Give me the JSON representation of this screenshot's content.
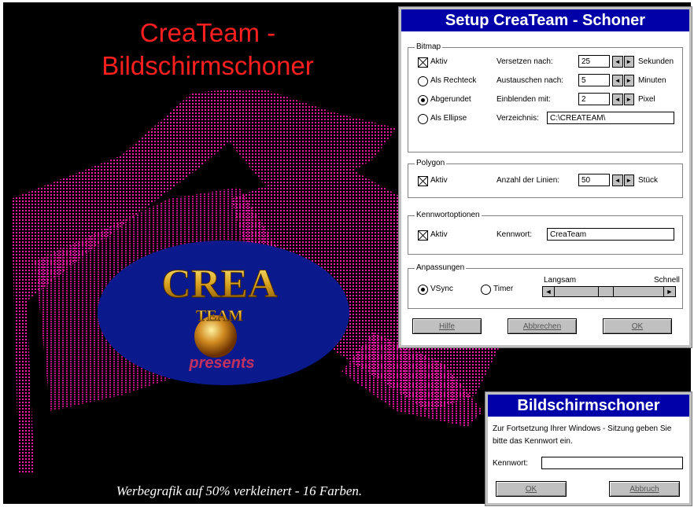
{
  "screen": {
    "headline_line1": "CreaTeam -",
    "headline_line2": "Bildschirmschoner",
    "logo": {
      "line1": "CREA",
      "line2": "TEAM",
      "line3": "presents"
    },
    "caption": "Werbegrafik auf 50% verkleinert - 16 Farben."
  },
  "setup": {
    "title": "Setup CreaTeam - Schoner",
    "bitmap": {
      "group_label": "Bitmap",
      "aktiv_label": "Aktiv",
      "rechteck_label": "Als Rechteck",
      "abgerundet_label": "Abgerundet",
      "ellipse_label": "Als Ellipse",
      "versetzen_label": "Versetzen nach:",
      "versetzen_value": "25",
      "versetzen_unit": "Sekunden",
      "austauschen_label": "Austauschen nach:",
      "austauschen_value": "5",
      "austauschen_unit": "Minuten",
      "einblenden_label": "Einblenden mit:",
      "einblenden_value": "2",
      "einblenden_unit": "Pixel",
      "verzeichnis_label": "Verzeichnis:",
      "verzeichnis_value": "C:\\CREATEAM\\",
      "selected_shape": "Abgerundet"
    },
    "polygon": {
      "group_label": "Polygon",
      "aktiv_label": "Aktiv",
      "linien_label": "Anzahl der Linien:",
      "linien_value": "50",
      "linien_unit": "Stück"
    },
    "kennwort": {
      "group_label": "Kennwortoptionen",
      "aktiv_label": "Aktiv",
      "kennwort_label": "Kennwort:",
      "kennwort_value": "CreaTeam"
    },
    "anpassungen": {
      "group_label": "Anpassungen",
      "vsync_label": "VSync",
      "timer_label": "Timer",
      "langsam_label": "Langsam",
      "schnell_label": "Schnell",
      "selected": "VSync",
      "speed_fraction": 0.45
    },
    "buttons": {
      "hilfe": "Hilfe",
      "abbrechen": "Abbrechen",
      "ok": "OK"
    }
  },
  "password_dialog": {
    "title": "Bildschirmschoner",
    "message_line1": "Zur Fortsetzung Ihrer Windows - Sitzung geben Sie",
    "message_line2": "bitte das Kennwort ein.",
    "kennwort_label": "Kennwort:",
    "kennwort_value": "",
    "ok": "OK",
    "abbruch": "Abbruch"
  },
  "colors": {
    "background": "#000000",
    "headline": "#ff1f1f",
    "polygon": "#ff1aa8",
    "title_bar": "#0000a8",
    "ellipse": "#0a1a8c"
  }
}
